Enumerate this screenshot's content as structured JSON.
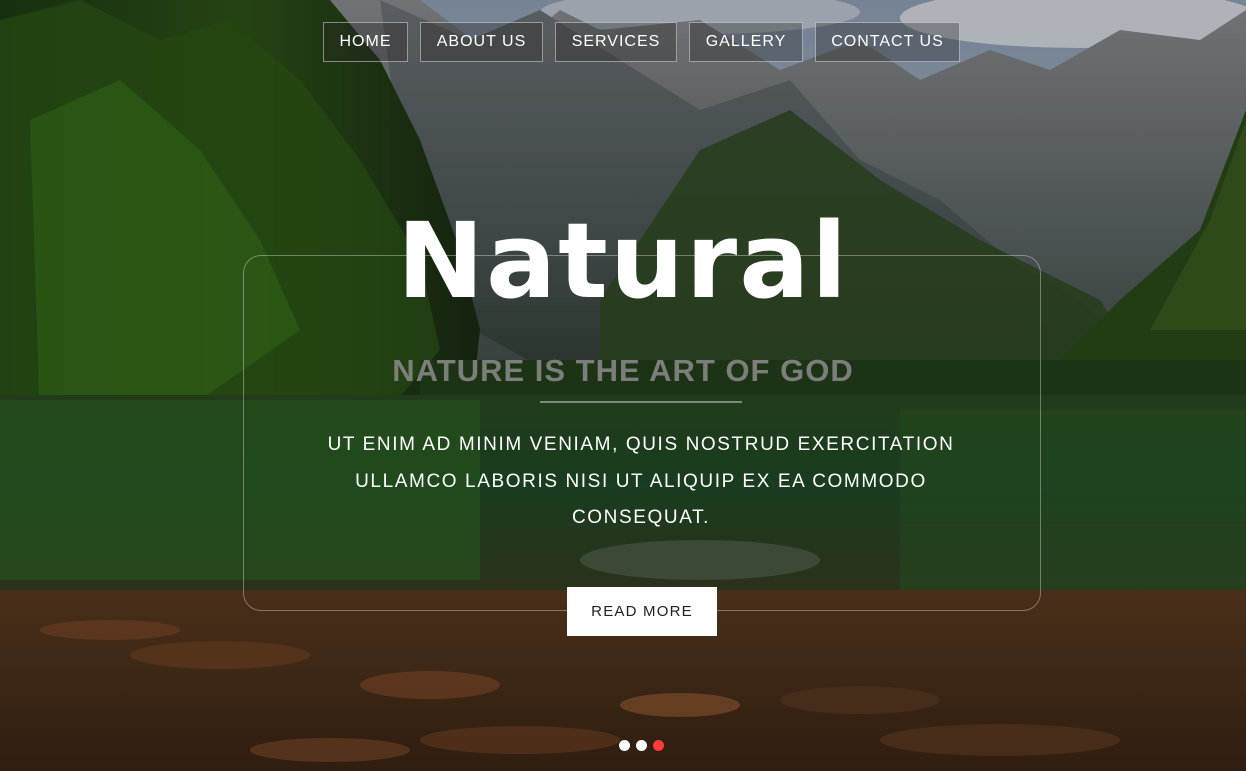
{
  "nav": {
    "items": [
      {
        "label": "HOME"
      },
      {
        "label": "ABOUT US"
      },
      {
        "label": "SERVICES"
      },
      {
        "label": "GALLERY"
      },
      {
        "label": "CONTACT US"
      }
    ]
  },
  "hero": {
    "title": "Natural",
    "subtitle": "NATURE IS THE ART OF GOD",
    "description": "UT ENIM AD MINIM VENIAM, QUIS NOSTRUD EXERCITATION ULLAMCO LABORIS NISI UT ALIQUIP EX EA COMMODO CONSEQUAT.",
    "button_label": "READ MORE"
  },
  "slider": {
    "active_index": 2,
    "slide_count": 3,
    "dot_color": "#ffffff",
    "active_dot_color": "#ff3b3b"
  },
  "colors": {
    "text": "#ffffff",
    "button_bg": "#ffffff",
    "button_text": "#222222"
  }
}
